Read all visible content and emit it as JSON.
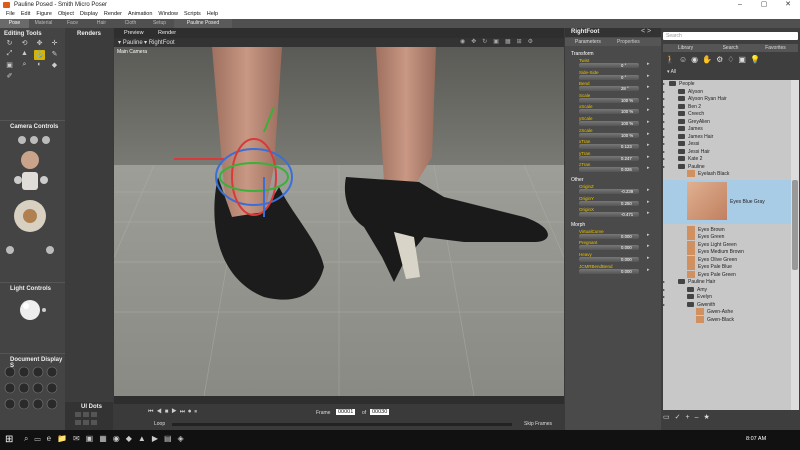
{
  "window": {
    "title": "Pauline Posed - Smith Micro Poser"
  },
  "menu": [
    "File",
    "Edit",
    "Figure",
    "Object",
    "Display",
    "Render",
    "Animation",
    "Window",
    "Scripts",
    "Help"
  ],
  "room_tabs": [
    {
      "label": "Pose",
      "active": true
    },
    {
      "label": "Material",
      "active": false
    },
    {
      "label": "Face",
      "active": false
    },
    {
      "label": "Hair",
      "active": false
    },
    {
      "label": "Cloth",
      "active": false
    },
    {
      "label": "Setup",
      "active": false
    }
  ],
  "scene_tab": "Pauline Posed",
  "editing_tools": {
    "title": "Editing Tools"
  },
  "renders": {
    "label": "Renders"
  },
  "camera_controls": {
    "title": "Camera Controls"
  },
  "light_controls": {
    "title": "Light Controls"
  },
  "document_display": {
    "title": "Document Display S"
  },
  "ui_dots": {
    "title": "UI Dots"
  },
  "viewport": {
    "tabs": [
      "Preview",
      "Render"
    ],
    "figure_select": "Pauline",
    "actor_select": "RightFoot",
    "camera_label": "Main Camera"
  },
  "params": {
    "actor": "RightFoot",
    "tabs": [
      "Parameters",
      "Properties"
    ],
    "groups": [
      {
        "name": "Transform",
        "items": [
          {
            "label": "Twist",
            "value": "0 °"
          },
          {
            "label": "Side-Side",
            "value": "0 °"
          },
          {
            "label": "Bend",
            "value": "28 °"
          },
          {
            "label": "Scale",
            "value": "100 %"
          },
          {
            "label": "xScale",
            "value": "100 %"
          },
          {
            "label": "yScale",
            "value": "100 %"
          },
          {
            "label": "zScale",
            "value": "100 %"
          },
          {
            "label": "xTran",
            "value": "0.123"
          },
          {
            "label": "yTran",
            "value": "0.247"
          },
          {
            "label": "zTran",
            "value": "0.026"
          }
        ]
      },
      {
        "name": "Other",
        "items": [
          {
            "label": "OriginZ",
            "value": "-0.239"
          },
          {
            "label": "OriginY",
            "value": "0.250"
          },
          {
            "label": "OriginX",
            "value": "-0.471"
          }
        ]
      },
      {
        "name": "Morph",
        "items": [
          {
            "label": "VirtualCurve",
            "value": "0.000"
          },
          {
            "label": "Pregnant",
            "value": "0.000"
          },
          {
            "label": "Heavy",
            "value": "0.000"
          },
          {
            "label": "JCMRBendBend",
            "value": "0.000"
          }
        ]
      }
    ]
  },
  "library": {
    "search_placeholder": "Search",
    "tabs": [
      "Library",
      "Search",
      "Favorites"
    ],
    "filter": "All",
    "items": [
      {
        "label": "People",
        "kind": "folder",
        "depth": 0
      },
      {
        "label": "Alyson",
        "kind": "folder",
        "depth": 1
      },
      {
        "label": "Alyson Ryan Hair",
        "kind": "folder",
        "depth": 1
      },
      {
        "label": "Ben 2",
        "kind": "folder",
        "depth": 1
      },
      {
        "label": "Creech",
        "kind": "folder",
        "depth": 1
      },
      {
        "label": "GreyAlien",
        "kind": "folder",
        "depth": 1
      },
      {
        "label": "James",
        "kind": "folder",
        "depth": 1
      },
      {
        "label": "James Hair",
        "kind": "folder",
        "depth": 1
      },
      {
        "label": "Jessi",
        "kind": "folder",
        "depth": 1
      },
      {
        "label": "Jessi Hair",
        "kind": "folder",
        "depth": 1
      },
      {
        "label": "Kate 2",
        "kind": "folder",
        "depth": 1
      },
      {
        "label": "Pauline",
        "kind": "folder",
        "depth": 1
      },
      {
        "label": "Eyelash Black",
        "kind": "thumb",
        "depth": 2
      },
      {
        "label": "Eyes Blue Gray",
        "kind": "selected",
        "depth": 2
      },
      {
        "label": "Eyes Brown",
        "kind": "thumb",
        "depth": 2
      },
      {
        "label": "Eyes Green",
        "kind": "thumb",
        "depth": 2
      },
      {
        "label": "Eyes Light Green",
        "kind": "thumb",
        "depth": 2
      },
      {
        "label": "Eyes Medium Brown",
        "kind": "thumb",
        "depth": 2
      },
      {
        "label": "Eyes Olive Green",
        "kind": "thumb",
        "depth": 2
      },
      {
        "label": "Eyes Pale Blue",
        "kind": "thumb",
        "depth": 2
      },
      {
        "label": "Eyes Pale Green",
        "kind": "thumb",
        "depth": 2
      },
      {
        "label": "Pauline Hair",
        "kind": "folder",
        "depth": 1
      },
      {
        "label": "Amy",
        "kind": "folder",
        "depth": 2
      },
      {
        "label": "Evelyn",
        "kind": "folder",
        "depth": 2
      },
      {
        "label": "Gwenith",
        "kind": "folder",
        "depth": 2
      },
      {
        "label": "Gwen-Ashe",
        "kind": "thumb",
        "depth": 3
      },
      {
        "label": "Gwen-Black",
        "kind": "thumb",
        "depth": 3
      }
    ]
  },
  "timeline": {
    "frame_label": "Frame",
    "frame_current": "00001",
    "frame_of": "of",
    "frame_total": "00030",
    "loop_label": "Loop",
    "skip_label": "Skip Frames"
  },
  "taskbar": {
    "clock": "8:07 AM"
  },
  "colors": {
    "accent": "#d8b400",
    "selected_row": "#a9cce6",
    "library_bg": "#c8c8c8"
  }
}
